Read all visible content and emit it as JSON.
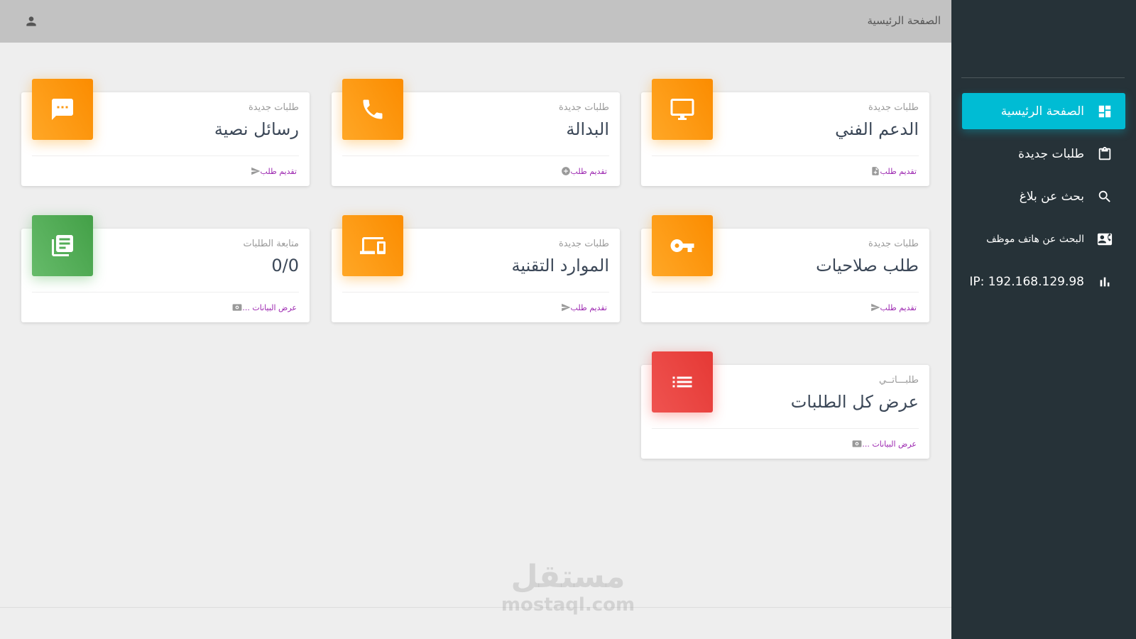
{
  "topbar": {
    "title": "الصفحة الرئيسية",
    "user_icon": "person-icon"
  },
  "sidebar": {
    "items": [
      {
        "label": "الصفحة الرئيسية",
        "icon": "dashboard-icon",
        "active": true
      },
      {
        "label": "طلبات جديدة",
        "icon": "clipboard-icon",
        "active": false
      },
      {
        "label": "بحث عن بلاغ",
        "icon": "search-icon",
        "active": false
      },
      {
        "label": "البحث عن هاتف موظف",
        "icon": "contact-card-icon",
        "active": false
      },
      {
        "label": "IP: 192.168.129.98",
        "icon": "bar-chart-icon",
        "active": false
      }
    ],
    "active_color": "#00bcd4",
    "background": "#263238"
  },
  "cards": [
    {
      "category": "طلبات جديدة",
      "title": "الدعم الفني",
      "icon": "monitor-icon",
      "color": "orange",
      "footer": "تقديم طلب",
      "footer_icon": "file-icon"
    },
    {
      "category": "طلبات جديدة",
      "title": "البدالة",
      "icon": "phone-icon",
      "color": "orange",
      "footer": "تقديم طلب",
      "footer_icon": "add-circle-icon"
    },
    {
      "category": "طلبات جديدة",
      "title": "رسائل نصية",
      "icon": "message-icon",
      "color": "orange",
      "footer": "تقديم طلب",
      "footer_icon": "send-icon"
    },
    {
      "category": "طلبات جديدة",
      "title": "طلب صلاحيات",
      "icon": "key-icon",
      "color": "orange",
      "footer": "تقديم طلب",
      "footer_icon": "send-icon"
    },
    {
      "category": "طلبات جديدة",
      "title": "الموارد التقنية",
      "icon": "devices-icon",
      "color": "orange",
      "footer": "تقديم طلب",
      "footer_icon": "send-icon"
    },
    {
      "category": "متابعة الطلبات",
      "title": "0/0",
      "icon": "library-books-icon",
      "color": "green",
      "footer": "عرض البيانات ...",
      "footer_icon": "view-icon"
    },
    {
      "category": "طلبـــاتــي",
      "title": "عرض كل الطلبات",
      "icon": "list-icon",
      "color": "red",
      "footer": "عرض البيانات ...",
      "footer_icon": "view-icon"
    }
  ],
  "watermark": {
    "arabic": "مستقل",
    "latin": "mostaql.com"
  }
}
